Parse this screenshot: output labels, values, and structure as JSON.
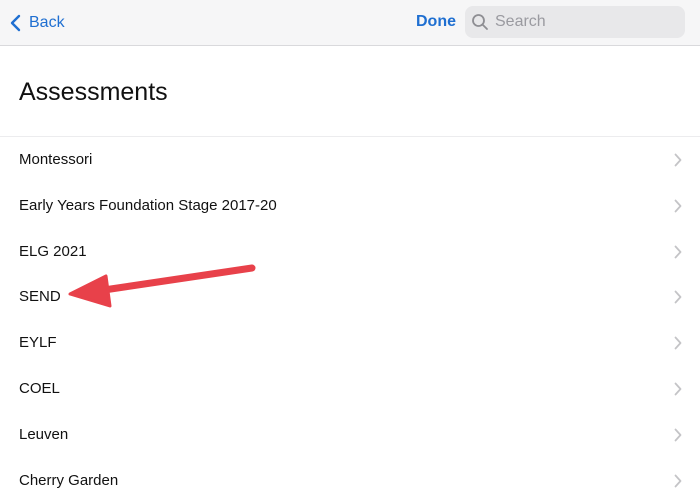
{
  "navbar": {
    "back_label": "Back",
    "done_label": "Done",
    "search_placeholder": "Search",
    "search_value": ""
  },
  "page": {
    "title": "Assessments"
  },
  "assessments": [
    {
      "label": "Montessori"
    },
    {
      "label": "Early Years Foundation Stage 2017-20"
    },
    {
      "label": "ELG 2021"
    },
    {
      "label": "SEND"
    },
    {
      "label": "EYLF"
    },
    {
      "label": "COEL"
    },
    {
      "label": "Leuven"
    },
    {
      "label": "Cherry Garden"
    }
  ],
  "colors": {
    "accent": "#1f6fd1",
    "annotation_arrow": "#e8414a"
  },
  "icons": {
    "back": "chevron-left-icon",
    "search": "magnifying-glass-icon",
    "row": "chevron-right-icon"
  }
}
